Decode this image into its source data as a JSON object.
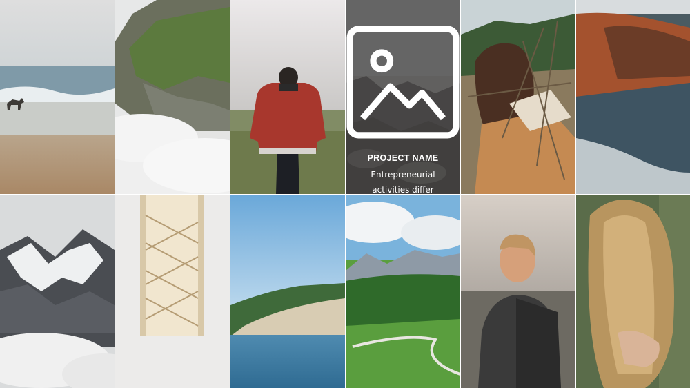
{
  "project": {
    "title": "PROJECT NAME",
    "description": "Entrepreneurial activities differ substantially depending on the type of organization.",
    "icon": "image-icon"
  },
  "colors": {
    "overlay": "#464646",
    "text": "#ffffff"
  }
}
